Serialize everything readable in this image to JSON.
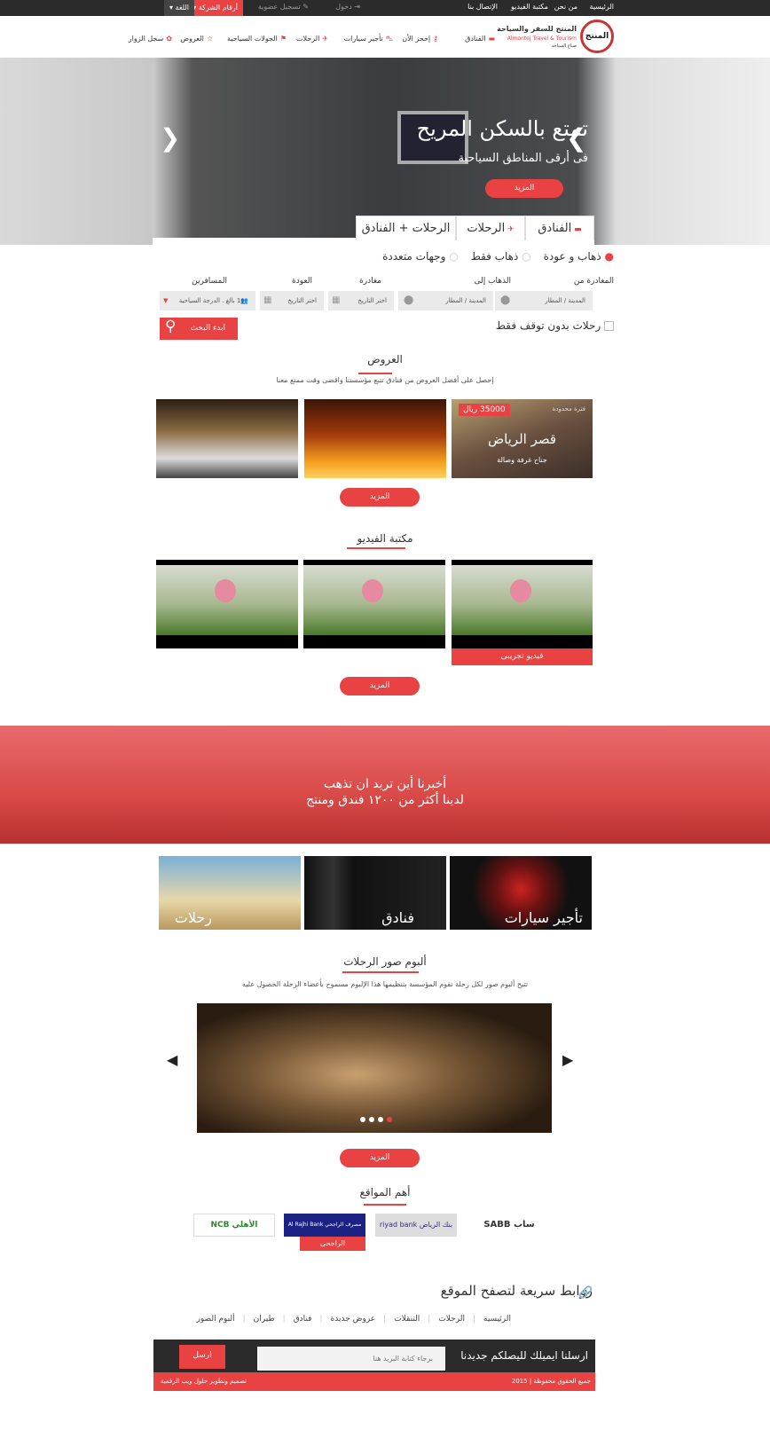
{
  "topbar": {
    "links": [
      "الرئيسية",
      "من نحن",
      "مكتبة الفيديو",
      "الإتصال بنا"
    ],
    "login": "دخول",
    "register": "تسجيل عضوية",
    "company_numbers": "أرقام الشركة",
    "language": "اللغة"
  },
  "logo": {
    "name_ar": "المنتج للسفر والسياحة",
    "name_en": "Almontej Travel & Tourism",
    "tagline": "صناع السياحة",
    "mark": "المنتج"
  },
  "nav": [
    {
      "label": "الفنادق",
      "icon": "bed-icon"
    },
    {
      "label": "إحجز الأن",
      "icon": "key-icon"
    },
    {
      "label": "تأجير سيارات",
      "icon": "car-icon"
    },
    {
      "label": "الرحلات",
      "icon": "plane-icon"
    },
    {
      "label": "الجولات السياحية",
      "icon": "flag-icon"
    },
    {
      "label": "العروض",
      "icon": "star-icon"
    },
    {
      "label": "سجل الزوار",
      "icon": "heart-icon"
    }
  ],
  "hero": {
    "title": "تمتع بالسكن المريح",
    "subtitle": "فى أرقى المناطق السياحية",
    "more": "المزيد"
  },
  "tabs": [
    "الفنادق",
    "الرحلات",
    "الرحلات + الفنادق"
  ],
  "search": {
    "trip_types": [
      "ذهاب و عودة",
      "ذهاب فقط",
      "وجهات متعددة"
    ],
    "selected_trip": "ذهاب و عودة",
    "labels": {
      "from": "المغادرة من",
      "to": "الذهاب إلى",
      "depart": "مغادرة",
      "return": "العودة",
      "passengers": "المسافرين"
    },
    "from_placeholder": "المدينة / المطار",
    "to_placeholder": "المدينة / المطار",
    "depart_placeholder": "اختر التاريخ",
    "return_placeholder": "اختر التاريخ",
    "passengers_value": "1 بالغ . الدرجة السياحية",
    "nonstop": "رحلات بدون توقف فقط",
    "search_button": "ابدء البحث"
  },
  "offers": {
    "title": "العروض",
    "subtitle": "إحصل على أفضل العروض من فنادق تتبع مؤسستنا واقضى وقت ممتع معنا",
    "featured": {
      "badge": "فترة محدودة",
      "price": "35000 ريال",
      "name": "قصر الرياض",
      "desc": "جناح غرفة وصالة"
    },
    "more": "المزيد"
  },
  "videos": {
    "title": "مكتبة الفيديو",
    "caption": "فيديو تجريبى",
    "more": "المزيد"
  },
  "banner": {
    "line1": "أخبرنا أين تريد ان تذهب",
    "line2": "لدينا أكثر من ١٢٠٠ فندق ومنتج"
  },
  "categories": [
    "تأجير سيارات",
    "فنادق",
    "رحلات"
  ],
  "album": {
    "title": "ألبوم صور الرحلات",
    "subtitle": "تتيح ألبوم صور لكل رحلة تقوم المؤسسة بتنظيمها هذا الإلبوم مسموح بأعضاء الرحلة الحصول عليه",
    "more": "المزيد",
    "slides": 4,
    "active_slide": 1
  },
  "sites": {
    "title": "أهم المواقع",
    "logos": [
      "ساب SABB",
      "بنك الرياض riyad bank",
      "مصرف الراجحي Al Rajhi Bank",
      "الأهلي NCB"
    ],
    "hover_label": "الراجحى"
  },
  "quicklinks": {
    "title": "روابط سريعة لتصفح الموقع",
    "links": [
      "الرئيسية",
      "الرحلات",
      "التنقلات",
      "عروض جديدة",
      "فنادق",
      "طيران",
      "ألبوم الصور"
    ]
  },
  "newsletter": {
    "label": "ارسلنا ايميلك لليصلكم جديدنا",
    "placeholder": "برجاء كتابة البريد هنا",
    "send": "ارسل"
  },
  "footer": {
    "copyright": "جميع الحقوق محفوظة | 2015",
    "credit": "تصميم وتطوير حلول ويب الرقمية"
  },
  "colors": {
    "accent": "#e94242",
    "dark": "#2b2b2b"
  }
}
